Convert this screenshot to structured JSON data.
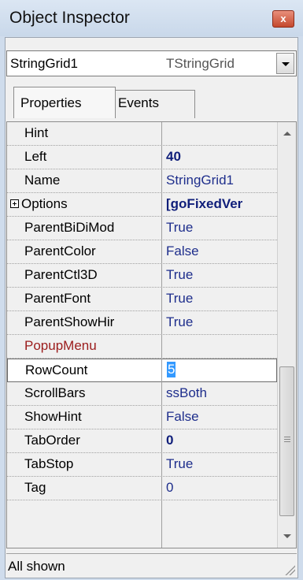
{
  "window": {
    "title": "Object Inspector",
    "close_label": "x"
  },
  "component_selector": {
    "name": "StringGrid1",
    "type": "TStringGrid"
  },
  "tabs": [
    {
      "label": "Properties",
      "active": true
    },
    {
      "label": "Events",
      "active": false
    }
  ],
  "properties": [
    {
      "name": "Hint",
      "value": ""
    },
    {
      "name": "Left",
      "value": "40"
    },
    {
      "name": "Name",
      "value": "StringGrid1"
    },
    {
      "name": "Options",
      "value": "[goFixedVer"
    },
    {
      "name": "ParentBiDiMod",
      "value": "True"
    },
    {
      "name": "ParentColor",
      "value": "False"
    },
    {
      "name": "ParentCtl3D",
      "value": "True"
    },
    {
      "name": "ParentFont",
      "value": "True"
    },
    {
      "name": "ParentShowHir",
      "value": "True"
    },
    {
      "name": "PopupMenu",
      "value": ""
    },
    {
      "name": "RowCount",
      "value": "5"
    },
    {
      "name": "ScrollBars",
      "value": "ssBoth"
    },
    {
      "name": "ShowHint",
      "value": "False"
    },
    {
      "name": "TabOrder",
      "value": "0"
    },
    {
      "name": "TabStop",
      "value": "True"
    },
    {
      "name": "Tag",
      "value": "0"
    }
  ],
  "status": {
    "text": "All shown"
  },
  "colors": {
    "value_text": "#1e2e8c",
    "highlight": "#3399ff",
    "popup_menu_name": "#9b1c1c",
    "close_button": "#c4482d"
  },
  "icons": {
    "close": "close-icon",
    "dropdown": "chevron-down-icon",
    "expand": "plus-box-icon",
    "scroll_up": "arrow-up-icon",
    "scroll_down": "arrow-down-icon",
    "resize": "size-grip-icon"
  }
}
